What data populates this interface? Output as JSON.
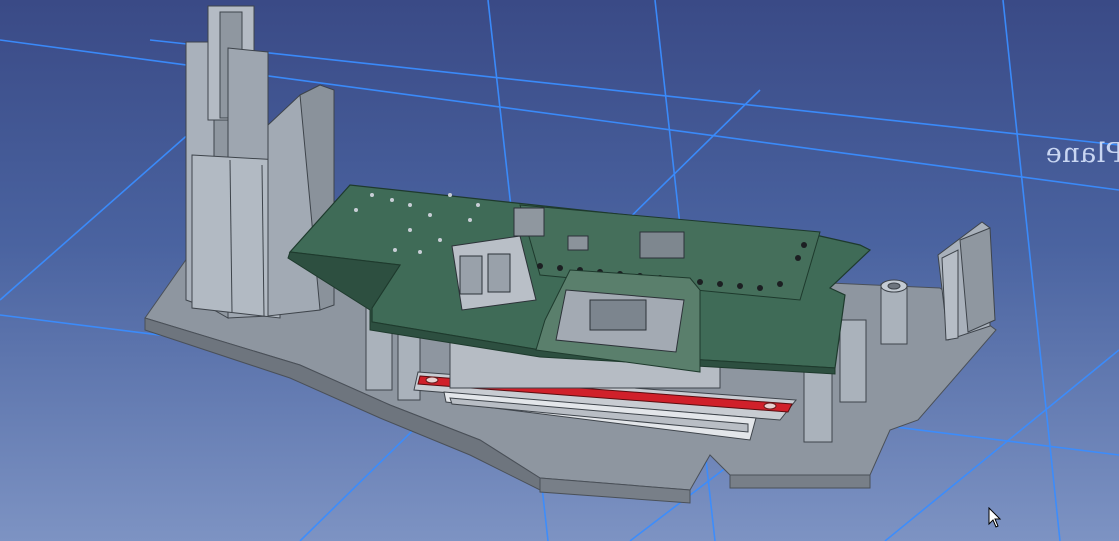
{
  "viewport": {
    "name": "3D view",
    "background_top": "#3a4a86",
    "background_bottom": "#7d93c3",
    "grid_color": "#3a8dff"
  },
  "plane_label": "Plane",
  "model": {
    "base_color": "#8e96a0",
    "pcb_color": "#3f6b57",
    "stripe_color": "#d0202a"
  },
  "icons": {
    "cursor": "mouse-pointer-icon"
  }
}
